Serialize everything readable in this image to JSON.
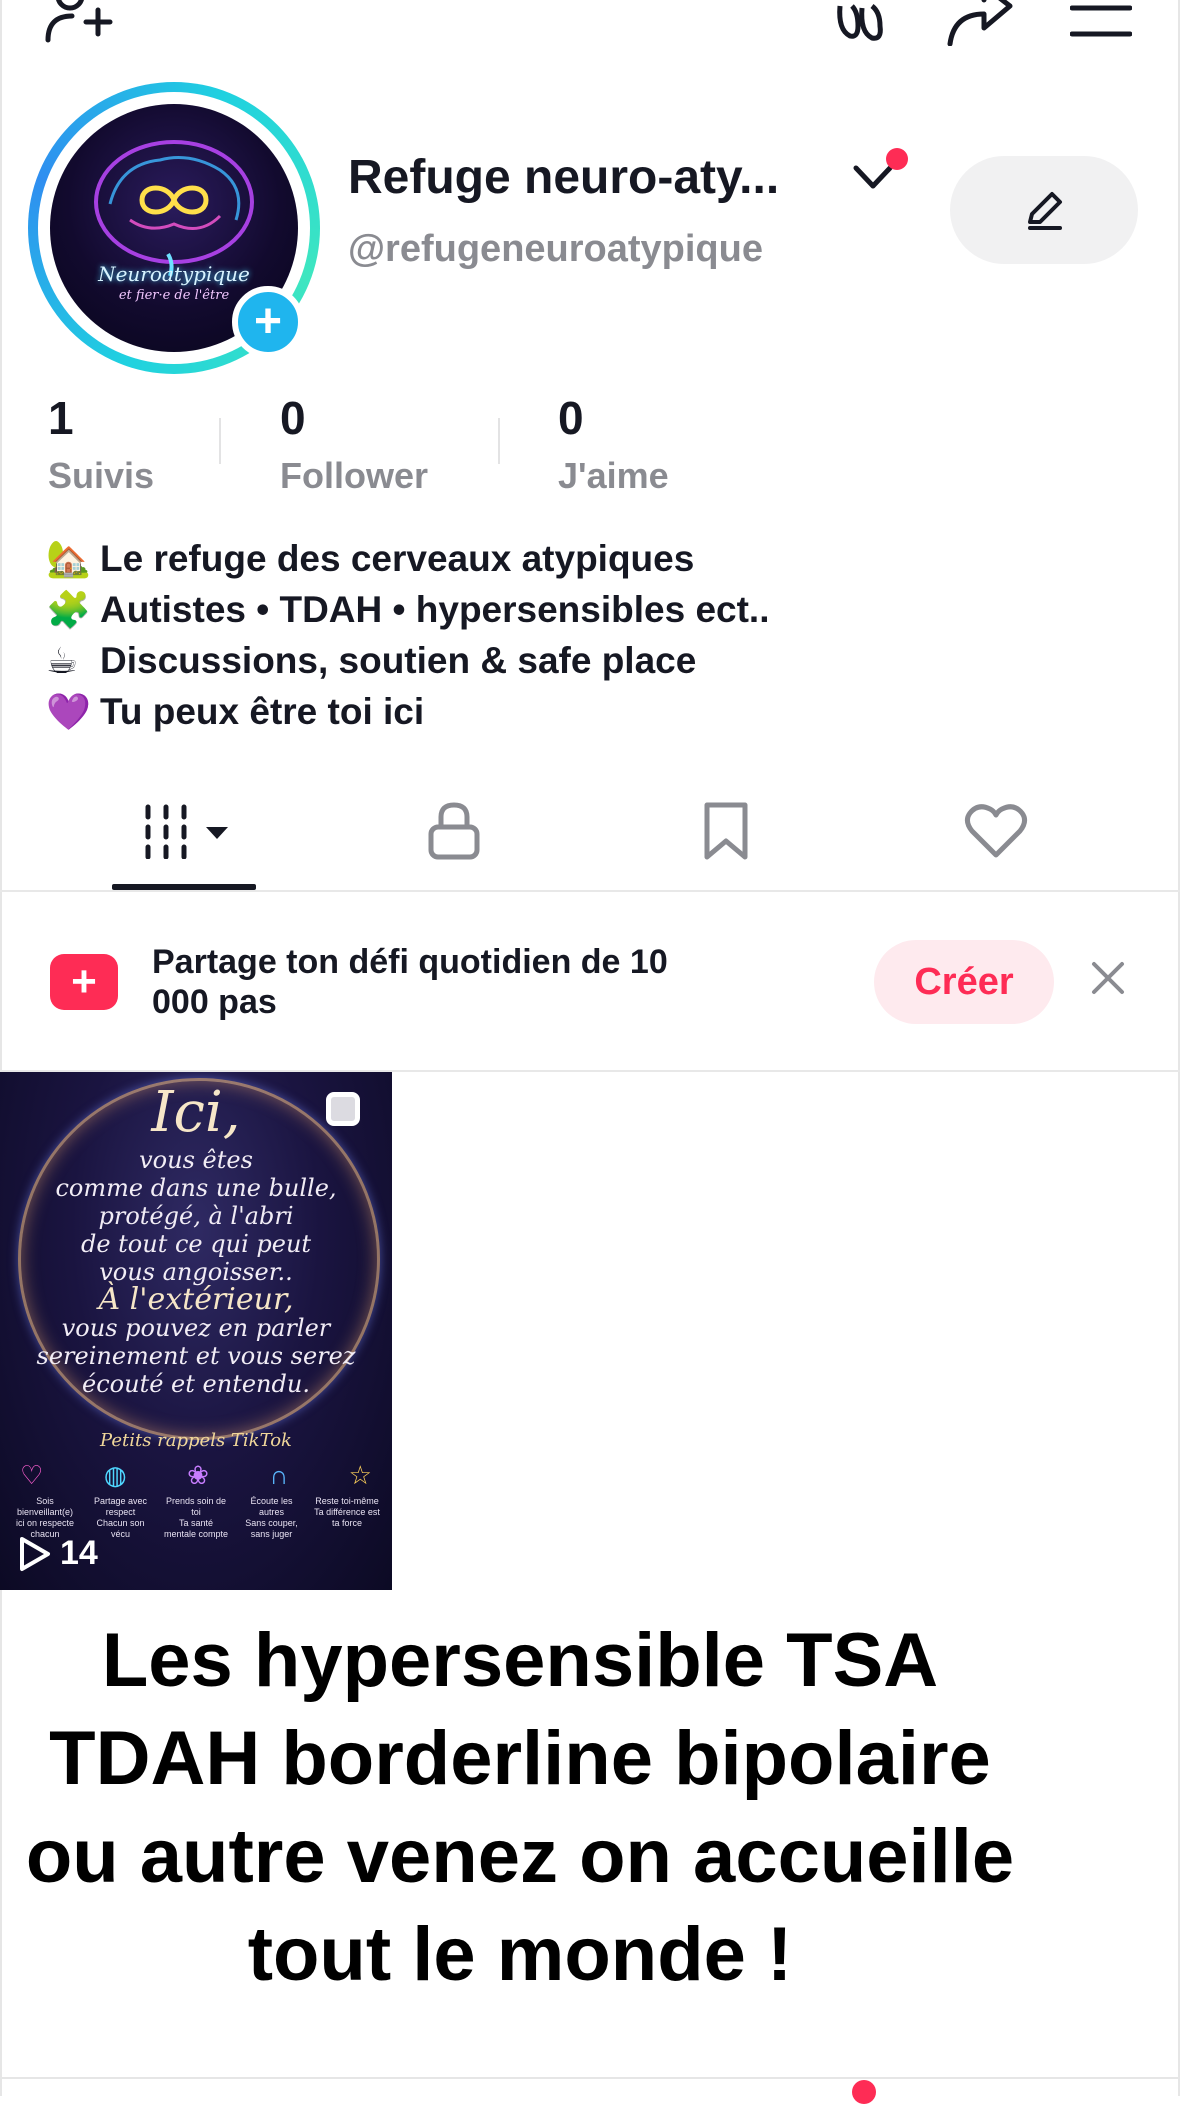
{
  "profile": {
    "name": "Refuge neuro-aty...",
    "handle": "@refugeneuroatypique",
    "avatar_text_1": "Neuroatypique",
    "avatar_text_2": "et fier·e de l'être"
  },
  "stats": [
    {
      "value": "1",
      "label": "Suivis"
    },
    {
      "value": "0",
      "label": "Follower"
    },
    {
      "value": "0",
      "label": "J'aime"
    }
  ],
  "bio": [
    {
      "emoji": "🏡",
      "text": "Le refuge des cerveaux atypiques"
    },
    {
      "emoji": "🧩",
      "text": "Autistes • TDAH • hypersensibles ect.."
    },
    {
      "emoji": "☕",
      "text": "Discussions, soutien & safe place"
    },
    {
      "emoji": "💜",
      "text": "Tu peux être toi ici"
    }
  ],
  "challenge": {
    "text": "Partage ton défi quotidien de 10 000 pas",
    "create_label": "Créer"
  },
  "video": {
    "views": "14",
    "title": "Ici,",
    "lines": [
      "vous êtes",
      "comme dans une bulle,",
      "protégé, à l'abri",
      "de tout ce qui peut",
      "vous angoisser..",
      "À l'extérieur,",
      "vous pouvez en parler",
      "sereinement et vous serez",
      "écouté et entendu."
    ],
    "reminder": "Petits rappels TikTok",
    "tips": [
      {
        "title": "Sois bienveillant(e)",
        "sub": "ici on respecte chacun"
      },
      {
        "title": "Partage avec respect",
        "sub": "Chacun son vécu"
      },
      {
        "title": "Prends soin de toi",
        "sub": "Ta santé mentale compte"
      },
      {
        "title": "Écoute les autres",
        "sub": "Sans couper, sans juger"
      },
      {
        "title": "Reste toi-même",
        "sub": "Ta différence est ta force"
      }
    ]
  },
  "caption": "Les hypersensible TSA TDAH borderline bipolaire ou autre venez on accueille tout le monde !",
  "colors": {
    "accent": "#fe2c55",
    "avatar_ring": "#1fd1e0",
    "avatar_plus": "#1fb5ee"
  }
}
